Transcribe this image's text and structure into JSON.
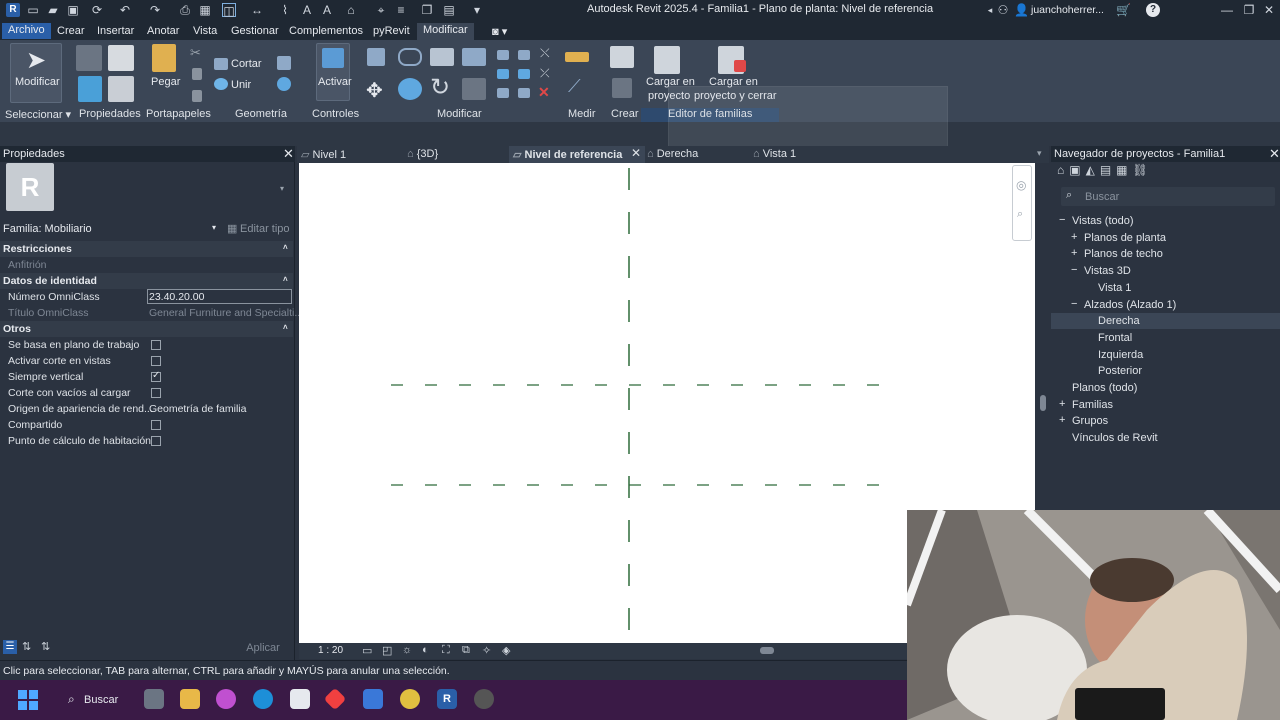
{
  "window": {
    "title": "Autodesk Revit 2025.4 - Familia1 - Plano de planta: Nivel de referencia",
    "user": "juanchoherrer..."
  },
  "menu": [
    "Archivo",
    "Crear",
    "Insertar",
    "Anotar",
    "Vista",
    "Gestionar",
    "Complementos",
    "pyRevit",
    "Modificar"
  ],
  "ribbon": {
    "modify": "Modificar",
    "paste": "Pegar",
    "cut": "Cortar",
    "join": "Unir",
    "activate": "Activar",
    "load_project_1": "Cargar en",
    "load_project_2": "proyecto",
    "load_close_1": "Cargar en",
    "load_close_2": "proyecto y cerrar",
    "panels": {
      "select": "Seleccionar",
      "properties": "Propiedades",
      "clipboard": "Portapapeles",
      "geometry": "Geometría",
      "controls": "Controles",
      "modify": "Modificar",
      "measure": "Medir",
      "create": "Crear",
      "family_editor": "Editor de familias"
    }
  },
  "properties": {
    "header": "Propiedades",
    "family": "Familia: Mobiliario",
    "edit_type": "Editar tipo",
    "sections": {
      "restrictions": "Restricciones",
      "identity": "Datos de identidad",
      "others": "Otros"
    },
    "host": "Anfitrión",
    "omniclass_number_label": "Número OmniClass",
    "omniclass_number": "23.40.20.00",
    "omniclass_title_label": "Título OmniClass",
    "omniclass_title": "General Furniture and Specialti...",
    "other_rows": [
      {
        "label": "Se basa en plano de trabajo",
        "checked": false
      },
      {
        "label": "Activar corte en vistas",
        "checked": false
      },
      {
        "label": "Siempre vertical",
        "checked": true
      },
      {
        "label": "Corte con vacíos al cargar",
        "checked": false
      },
      {
        "label": "Compartido",
        "checked": false
      },
      {
        "label": "Punto de cálculo de habitación",
        "checked": false
      }
    ],
    "appearance_label": "Origen de apariencia de rend...",
    "appearance_value": "Geometría de familia",
    "apply": "Aplicar"
  },
  "tabs": [
    "Nivel 1",
    "{3D}",
    "Nivel de referencia",
    "Derecha",
    "Vista 1"
  ],
  "viewbar": {
    "scale": "1 : 20"
  },
  "navigator": {
    "header": "Navegador de proyectos - Familia1",
    "search_placeholder": "Buscar",
    "items": [
      {
        "label": "Vistas (todo)",
        "level": 0,
        "toggle": "−"
      },
      {
        "label": "Planos de planta",
        "level": 1,
        "toggle": "+"
      },
      {
        "label": "Planos de techo",
        "level": 1,
        "toggle": "+"
      },
      {
        "label": "Vistas 3D",
        "level": 1,
        "toggle": "−"
      },
      {
        "label": "Vista 1",
        "level": 2,
        "toggle": ""
      },
      {
        "label": "Alzados (Alzado 1)",
        "level": 1,
        "toggle": "−"
      },
      {
        "label": "Derecha",
        "level": 2,
        "toggle": "",
        "selected": true
      },
      {
        "label": "Frontal",
        "level": 2,
        "toggle": ""
      },
      {
        "label": "Izquierda",
        "level": 2,
        "toggle": ""
      },
      {
        "label": "Posterior",
        "level": 2,
        "toggle": ""
      },
      {
        "label": "Planos (todo)",
        "level": 0,
        "toggle": ""
      },
      {
        "label": "Familias",
        "level": 0,
        "toggle": "+"
      },
      {
        "label": "Grupos",
        "level": 0,
        "toggle": "+"
      },
      {
        "label": "Vínculos de Revit",
        "level": 0,
        "toggle": ""
      }
    ]
  },
  "status": "Clic para seleccionar, TAB para alternar, CTRL para añadir y MAYÚS para anular una selección.",
  "taskbar": {
    "search": "Buscar"
  },
  "colors": {
    "accent": "#2a5fa8",
    "ref_plane": "#2f6b3a"
  }
}
